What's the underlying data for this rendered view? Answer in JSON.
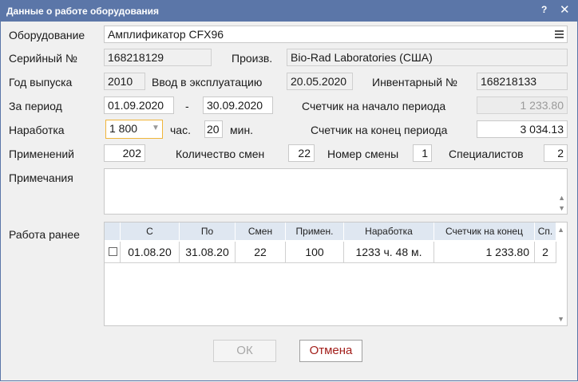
{
  "window": {
    "title": "Данные о работе оборудования",
    "help": "?",
    "close": "✕"
  },
  "equipment": {
    "label": "Оборудование",
    "value": "Амплификатор CFX96"
  },
  "serial": {
    "label": "Серийный №",
    "value": "168218129"
  },
  "manufacturer": {
    "label": "Произв.",
    "value": "Bio-Rad Laboratories (США)"
  },
  "year": {
    "label": "Год выпуска",
    "value": "2010"
  },
  "commissioning": {
    "label": "Ввод в эксплуатацию",
    "value": "20.05.2020"
  },
  "inventory": {
    "label": "Инвентарный №",
    "value": "168218133"
  },
  "period": {
    "label": "За период",
    "from": "01.09.2020",
    "dash": "-",
    "to": "30.09.2020"
  },
  "counter_start": {
    "label": "Счетчик на начало периода",
    "value": "1 233.80"
  },
  "operating": {
    "label": "Наработка",
    "hours": "1 800",
    "hours_unit": "час.",
    "minutes": "20",
    "minutes_unit": "мин."
  },
  "counter_end": {
    "label": "Счетчик на конец периода",
    "value": "3 034.13"
  },
  "applications": {
    "label": "Применений",
    "value": "202"
  },
  "shifts_count": {
    "label": "Количество смен",
    "value": "22"
  },
  "shift_number": {
    "label": "Номер смены",
    "value": "1"
  },
  "specialists": {
    "label": "Специалистов",
    "value": "2"
  },
  "notes": {
    "label": "Примечания",
    "value": ""
  },
  "history": {
    "label": "Работа ранее",
    "columns": [
      "С",
      "По",
      "Смен",
      "Примен.",
      "Наработка",
      "Счетчик на конец",
      "Сп."
    ],
    "rows": [
      [
        "01.08.20",
        "31.08.20",
        "22",
        "100",
        "1233 ч. 48 м.",
        "1 233.80",
        "2"
      ]
    ]
  },
  "buttons": {
    "ok": "ОК",
    "cancel": "Отмена"
  },
  "colors": {
    "titlebar": "#5b76a8",
    "cancel_text": "#a3201c",
    "grid_header": "#dfe7f1"
  }
}
